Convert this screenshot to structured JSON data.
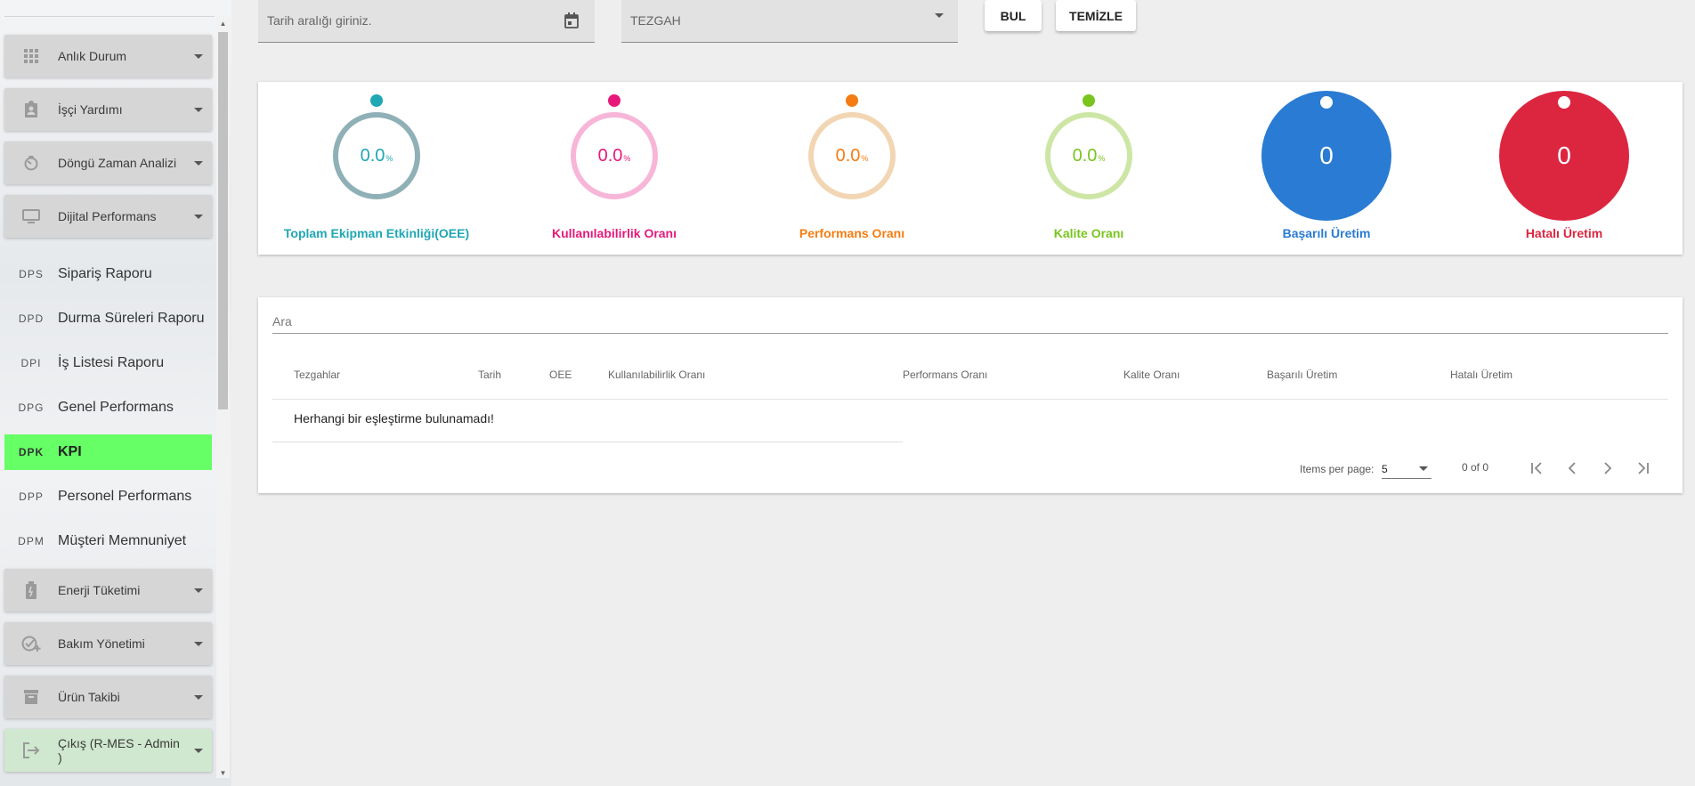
{
  "sidebar": {
    "menus": [
      {
        "label": "Anlık Durum",
        "icon": "grid-icon"
      },
      {
        "label": "İşçi Yardımı",
        "icon": "badge-icon"
      },
      {
        "label": "Döngü Zaman Analizi",
        "icon": "timer-icon"
      },
      {
        "label": "Dijital Performans",
        "icon": "monitor-icon"
      }
    ],
    "subitems": [
      {
        "abbr": "DPS",
        "label": "Sipariş Raporu",
        "active": false
      },
      {
        "abbr": "DPD",
        "label": "Durma Süreleri Raporu",
        "active": false
      },
      {
        "abbr": "DPI",
        "label": "İş Listesi Raporu",
        "active": false
      },
      {
        "abbr": "DPG",
        "label": "Genel Performans",
        "active": false
      },
      {
        "abbr": "DPK",
        "label": "KPI",
        "active": true
      },
      {
        "abbr": "DPP",
        "label": "Personel Performans",
        "active": false
      },
      {
        "abbr": "DPM",
        "label": "Müşteri Memnuniyet",
        "active": false
      }
    ],
    "menus_bottom": [
      {
        "label": "Enerji Tüketimi",
        "icon": "battery-icon"
      },
      {
        "label": "Bakım Yönetimi",
        "icon": "maintenance-icon"
      },
      {
        "label": "Ürün Takibi",
        "icon": "archive-icon"
      },
      {
        "label": "Çıkış (R-MES - Admin )",
        "icon": "logout-icon"
      }
    ]
  },
  "filters": {
    "date_placeholder": "Tarih aralığı giriniz.",
    "machine_value": "TEZGAH",
    "find_label": "BUL",
    "clear_label": "TEMİZLE"
  },
  "kpis": [
    {
      "value": "0.0",
      "unit": "%",
      "label": "Toplam Ekipman Etkinliği(OEE)",
      "color": "#1fa7b4",
      "ring": "#8fb0b6",
      "type": "ring"
    },
    {
      "value": "0.0",
      "unit": "%",
      "label": "Kullanılabilirlik Oranı",
      "color": "#e6197a",
      "ring": "#f7b6d8",
      "type": "ring"
    },
    {
      "value": "0.0",
      "unit": "%",
      "label": "Performans Oranı",
      "color": "#f57c12",
      "ring": "#f2d6b4",
      "type": "ring"
    },
    {
      "value": "0.0",
      "unit": "%",
      "label": "Kalite Oranı",
      "color": "#79c41f",
      "ring": "#cde6a6",
      "type": "ring"
    },
    {
      "value": "0",
      "label": "Başarılı Üretim",
      "color": "#2a7bd3",
      "type": "disc"
    },
    {
      "value": "0",
      "label": "Hatalı Üretim",
      "color": "#dc2640",
      "type": "disc"
    }
  ],
  "table": {
    "search_placeholder": "Ara",
    "columns": [
      "Tezgahlar",
      "Tarih",
      "OEE",
      "Kullanılabilirlik Oranı",
      "Performans Oranı",
      "Kalite Oranı",
      "Başarılı Üretim",
      "Hatalı Üretim"
    ],
    "empty_message": "Herhangi bir eşleştirme bulunamadı!",
    "items_per_page_label": "Items per page:",
    "items_per_page_value": "5",
    "range": "0 of 0"
  }
}
